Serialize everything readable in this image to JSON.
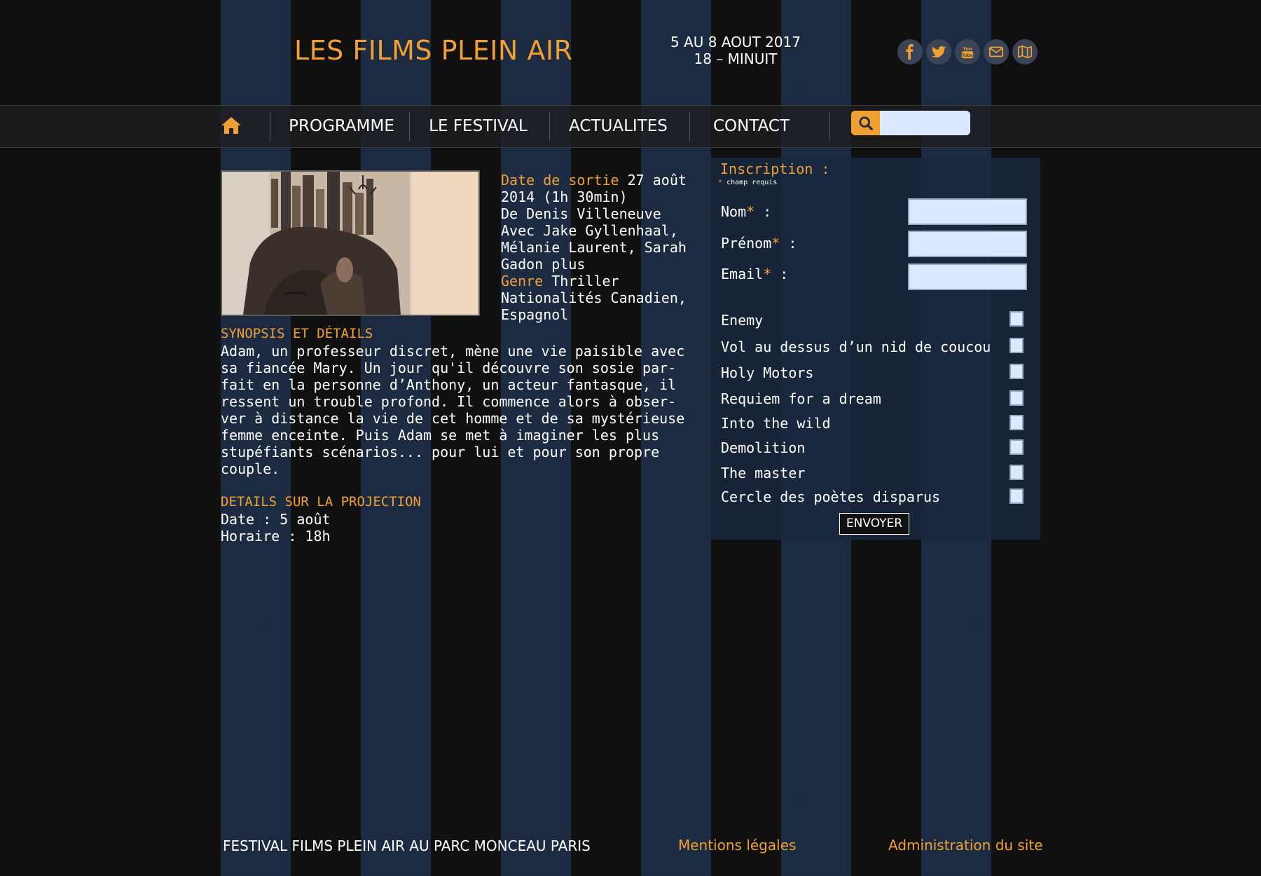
{
  "header": {
    "title": "LES FILMS PLEIN AIR",
    "dates_line1": "5 AU 8 AOUT 2017",
    "dates_line2": "18 – MINUIT",
    "social": [
      "facebook-icon",
      "twitter-icon",
      "youtube-icon",
      "mail-icon",
      "map-icon"
    ]
  },
  "nav": {
    "items": [
      "PROGRAMME",
      "LE FESTIVAL",
      "ACTUALITES",
      "CONTACT"
    ],
    "search_placeholder": ""
  },
  "film": {
    "release_label": "Date de sortie",
    "release_value": "27 août 2014 (1h 30min)",
    "director": "De Denis Villeneuve",
    "cast": "Avec Jake Gyllenhaal, Mélanie Laurent, Sarah Gadon plus",
    "genre_label": "Genre",
    "genre_value": "Thriller",
    "nationalities": "Nationalités Canadien, Espagnol",
    "synopsis_title": "SYNOPSIS ET DÉTAILS",
    "synopsis_lines": [
      "Adam, un professeur discret, mène une vie paisible avec",
      "sa fiancée Mary. Un jour qu'il découvre son sosie par-",
      "fait en la personne d’Anthony, un acteur fantasque, il",
      "ressent un trouble profond. Il commence alors à obser-",
      "ver à distance la vie de cet homme et de sa mystérieuse",
      "femme enceinte. Puis Adam se met à imaginer les plus",
      "stupéfiants scénarios... pour lui et pour son propre",
      "couple."
    ],
    "projection_title": "DETAILS SUR LA PROJECTION",
    "projection_date": "Date : 5 août",
    "projection_time": "Horaire : 18h"
  },
  "form": {
    "title": "Inscription :",
    "required_note": "champ requis",
    "required_mark": "*",
    "fields": [
      {
        "label": "Nom",
        "suffix": " :"
      },
      {
        "label": "Prénom",
        "suffix": " :"
      },
      {
        "label": "Email",
        "suffix": " :"
      }
    ],
    "films": [
      "Enemy",
      "Vol au dessus d’un nid de coucou",
      "Holy Motors",
      "Requiem for a dream",
      "Into the wild",
      "Demolition",
      "The master",
      "Cercle des poètes disparus"
    ],
    "submit_label": "ENVOYER"
  },
  "footer": {
    "text": "FESTIVAL FILMS PLEIN AIR AU PARC MONCEAU PARIS",
    "legal": "Mentions légales",
    "admin": "Administration du site"
  },
  "colors": {
    "accent": "#f0a030",
    "stripe": "#1d2d45",
    "background": "#101010"
  }
}
